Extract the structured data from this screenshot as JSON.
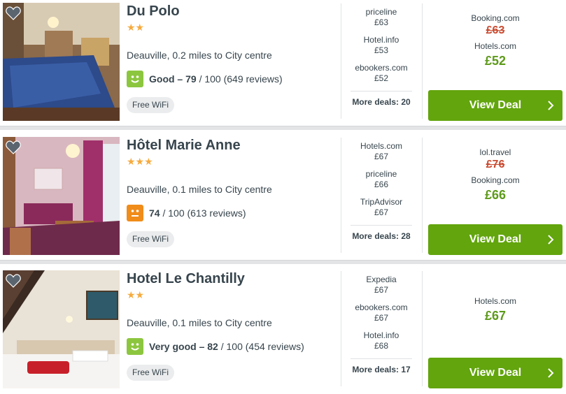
{
  "hotels": [
    {
      "name": "Du Polo",
      "stars": "★★",
      "location": "Deauville, 0.2 miles to City centre",
      "rating_label": "Good – 79",
      "rating_rest": " / 100 (649 reviews)",
      "rating_color": "#8cc63f",
      "amenity": "Free WiFi",
      "deals": [
        {
          "provider": "priceline",
          "price": "£63"
        },
        {
          "provider": "Hotel.info",
          "price": "£53"
        },
        {
          "provider": "ebookers.com",
          "price": "£52"
        }
      ],
      "more_deals": "More deals: 20",
      "old_provider": "Booking.com",
      "old_price": "£63",
      "best_provider": "Hotels.com",
      "best_price": "£52",
      "cta": "View Deal"
    },
    {
      "name": "Hôtel Marie Anne",
      "stars": "★★★",
      "location": "Deauville, 0.1 miles to City centre",
      "rating_label": "74",
      "rating_rest": " / 100 (613 reviews)",
      "rating_color": "#f08c1a",
      "amenity": "Free WiFi",
      "deals": [
        {
          "provider": "Hotels.com",
          "price": "£67"
        },
        {
          "provider": "priceline",
          "price": "£66"
        },
        {
          "provider": "TripAdvisor",
          "price": "£67"
        }
      ],
      "more_deals": "More deals: 28",
      "old_provider": "lol.travel",
      "old_price": "£76",
      "best_provider": "Booking.com",
      "best_price": "£66",
      "cta": "View Deal"
    },
    {
      "name": "Hotel Le Chantilly",
      "stars": "★★",
      "location": "Deauville, 0.1 miles to City centre",
      "rating_label": "Very good – 82",
      "rating_rest": " / 100 (454 reviews)",
      "rating_color": "#8cc63f",
      "amenity": "Free WiFi",
      "deals": [
        {
          "provider": "Expedia",
          "price": "£67"
        },
        {
          "provider": "ebookers.com",
          "price": "£67"
        },
        {
          "provider": "Hotel.info",
          "price": "£68"
        }
      ],
      "more_deals": "More deals: 17",
      "best_provider": "Hotels.com",
      "best_price": "£67",
      "cta": "View Deal"
    }
  ]
}
